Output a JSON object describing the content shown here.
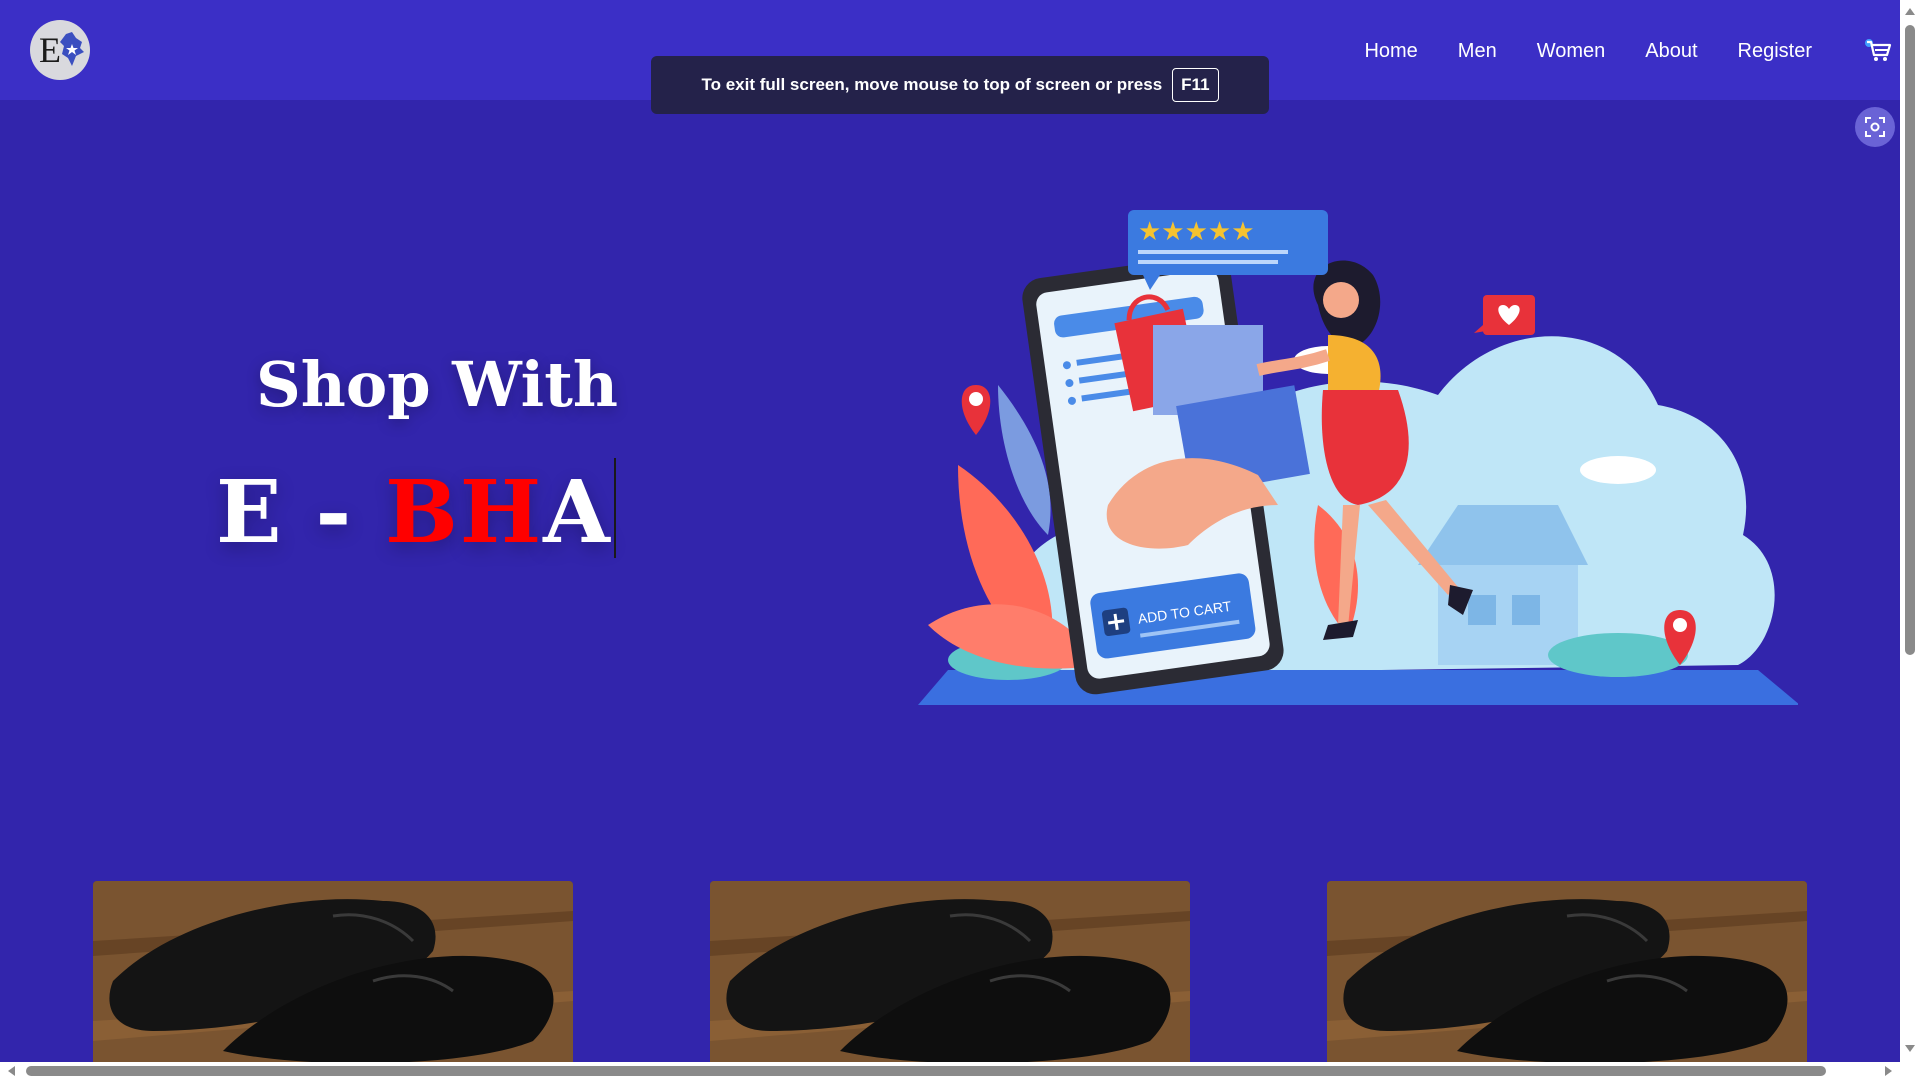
{
  "logo": {
    "text": "E",
    "alt": "E-BHA logo"
  },
  "nav": {
    "items": [
      {
        "label": "Home"
      },
      {
        "label": "Men"
      },
      {
        "label": "Women"
      },
      {
        "label": "About"
      },
      {
        "label": "Register"
      }
    ],
    "cart_icon": "shopping-cart-icon"
  },
  "toast": {
    "message": "To exit full screen, move mouse to top of screen or press",
    "key": "F11"
  },
  "hero": {
    "line1": "Shop With",
    "line2_prefix": "E - ",
    "line2_highlight": "BH",
    "line2_suffix": "A"
  },
  "illustration": {
    "button_text": "ADD TO CART",
    "rating_stars": 5
  },
  "products": [
    {
      "image": "black-leather-shoes"
    },
    {
      "image": "black-leather-shoes"
    },
    {
      "image": "black-leather-shoes"
    }
  ],
  "colors": {
    "background": "#3225ac",
    "navbar": "#3b2fc6",
    "highlight": "#ff0000"
  }
}
